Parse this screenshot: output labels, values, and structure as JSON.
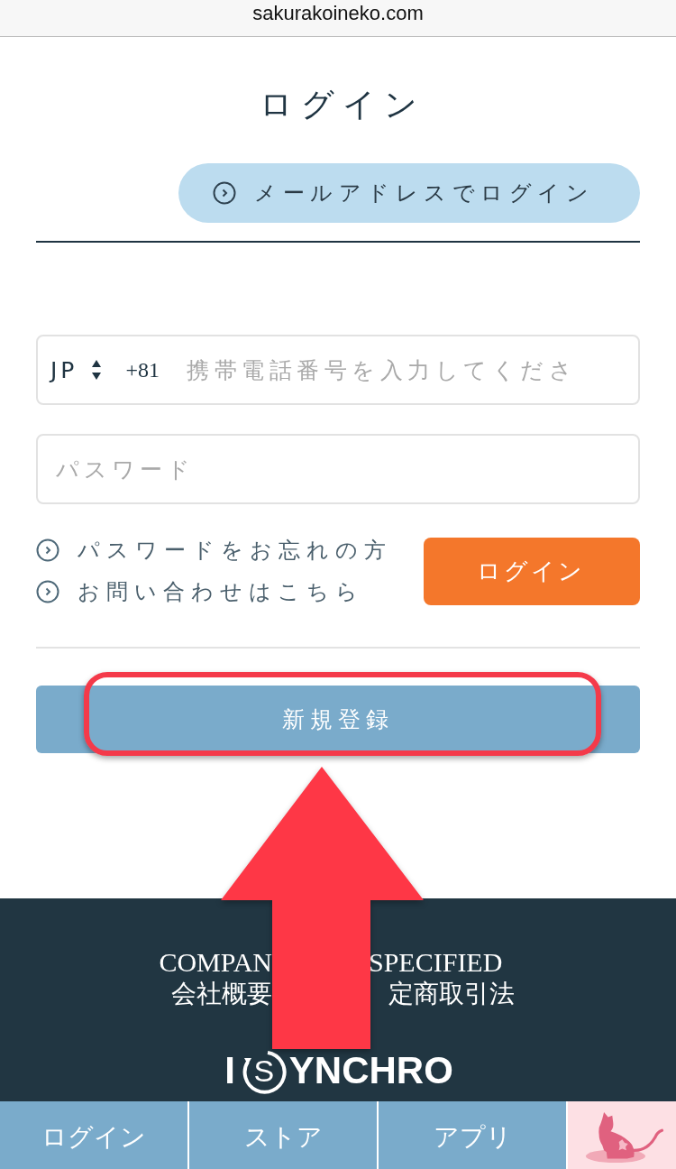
{
  "browser": {
    "address": "sakurakoineko.com"
  },
  "login": {
    "title": "ログイン",
    "email_button": "メールアドレスでログイン",
    "phone_field": {
      "country": "JP",
      "dial_code": "+81",
      "placeholder": "携帯電話番号を入力してくださ"
    },
    "password_field": {
      "placeholder": "パスワード"
    },
    "links": [
      "パスワードをお忘れの方",
      "お問い合わせはこちら"
    ],
    "login_button": "ログイン",
    "register_button": "新規登録"
  },
  "footer": {
    "links": [
      {
        "en": "COMPAN",
        "ja": "会社概要"
      },
      {
        "en": "SPECIFIED",
        "ja": "定商取引法"
      }
    ],
    "logo": {
      "prefix": "I",
      "ring_letter": "S",
      "suffix": "YNCHRO"
    }
  },
  "bottom_nav": [
    {
      "kind": "text",
      "label": "ログイン"
    },
    {
      "kind": "text",
      "label": "ストア"
    },
    {
      "kind": "text",
      "label": "アプリ"
    },
    {
      "kind": "mascot"
    }
  ]
}
